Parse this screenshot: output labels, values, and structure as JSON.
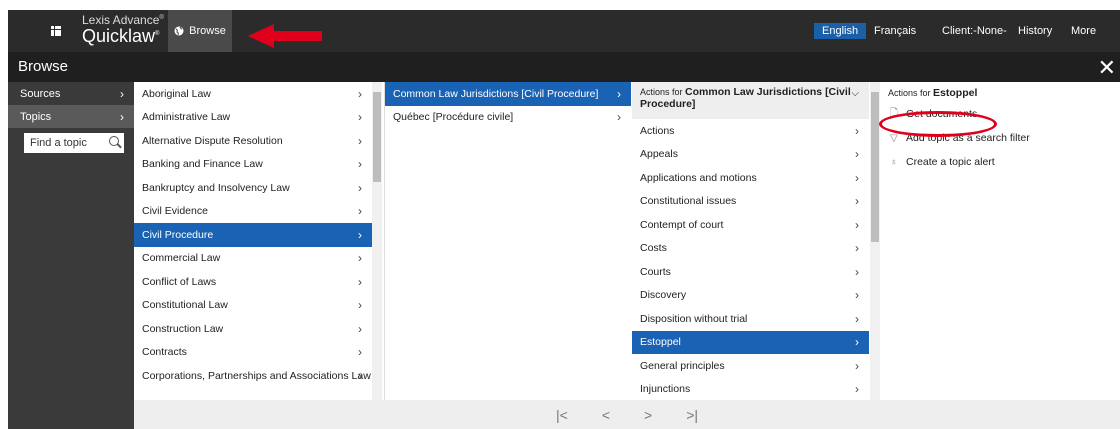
{
  "header": {
    "brand_line1": "Lexis Advance",
    "brand_line2": "Quicklaw",
    "browse_label": "Browse",
    "lang_english": "English",
    "lang_french": "Français",
    "client": "Client:-None-",
    "history": "History",
    "more": "More"
  },
  "panel": {
    "title": "Browse",
    "left_nav": [
      {
        "label": "Sources",
        "selected": false
      },
      {
        "label": "Topics",
        "selected": true
      }
    ],
    "find_placeholder": "Find a topic"
  },
  "topics": [
    {
      "label": "Aboriginal Law"
    },
    {
      "label": "Administrative Law"
    },
    {
      "label": "Alternative Dispute Resolution"
    },
    {
      "label": "Banking and Finance Law"
    },
    {
      "label": "Bankruptcy and Insolvency Law"
    },
    {
      "label": "Civil Evidence"
    },
    {
      "label": "Civil Procedure",
      "selected": true
    },
    {
      "label": "Commercial Law"
    },
    {
      "label": "Conflict of Laws"
    },
    {
      "label": "Constitutional Law"
    },
    {
      "label": "Construction Law"
    },
    {
      "label": "Contracts"
    },
    {
      "label": "Corporations, Partnerships and Associations Law"
    }
  ],
  "jurisdictions": [
    {
      "label": "Common Law Jurisdictions [Civil Procedure]",
      "selected": true
    },
    {
      "label": "Québec [Procédure civile]"
    }
  ],
  "subtopics_header": {
    "prefix": "Actions for",
    "name": "Common Law Jurisdictions [Civil Procedure]"
  },
  "subtopics": [
    {
      "label": "Actions"
    },
    {
      "label": "Appeals"
    },
    {
      "label": "Applications and motions"
    },
    {
      "label": "Constitutional issues"
    },
    {
      "label": "Contempt of court"
    },
    {
      "label": "Costs"
    },
    {
      "label": "Courts"
    },
    {
      "label": "Discovery"
    },
    {
      "label": "Disposition without trial"
    },
    {
      "label": "Estoppel",
      "selected": true
    },
    {
      "label": "General principles"
    },
    {
      "label": "Injunctions"
    }
  ],
  "actions_header": {
    "prefix": "Actions for",
    "name": "Estoppel"
  },
  "actions": [
    {
      "label": "Get documents",
      "icon": "document-icon"
    },
    {
      "label": "Add topic as a search filter",
      "icon": "filter-icon"
    },
    {
      "label": "Create a topic alert",
      "icon": "bell-icon"
    }
  ],
  "pager": {
    "first": "|<",
    "prev": "<",
    "next": ">",
    "last": ">|"
  },
  "colors": {
    "accent": "#1a62b3",
    "topbar": "#2b2b2b",
    "highlight_red": "#e0001b"
  }
}
